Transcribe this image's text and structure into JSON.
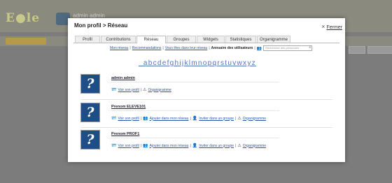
{
  "background": {
    "logo": "E●le",
    "user_name": "admin admin"
  },
  "modal": {
    "title": "Mon profil > Réseau",
    "close_label": "Fermer",
    "tabs": [
      {
        "label": "Profil"
      },
      {
        "label": "Contributions"
      },
      {
        "label": "Réseau",
        "active": true
      },
      {
        "label": "Groupes"
      },
      {
        "label": "Widgets"
      },
      {
        "label": "Statistiques"
      },
      {
        "label": "Organigramme"
      }
    ],
    "subnav": {
      "my_network": "Mon réseau",
      "recommendations": "Recommandations",
      "in_networks": "Vous êtes dans leur réseau",
      "directory": "Annuaire des utilisateurs",
      "search_placeholder": "Rechercher des personnes"
    },
    "alphabet": "_abcdefghijklmnopqrstuvwxyz",
    "actions": {
      "view_profile": "Voir son profil",
      "add_to_network": "Ajouter dans mon réseau",
      "invite_group": "Inviter dans un groupe",
      "org_chart": "Organigramme"
    },
    "users": [
      {
        "name": "admin admin",
        "self": true
      },
      {
        "name": "Prenom ELEVE101",
        "self": false
      },
      {
        "name": "Prenom PROF1",
        "self": false
      }
    ]
  }
}
